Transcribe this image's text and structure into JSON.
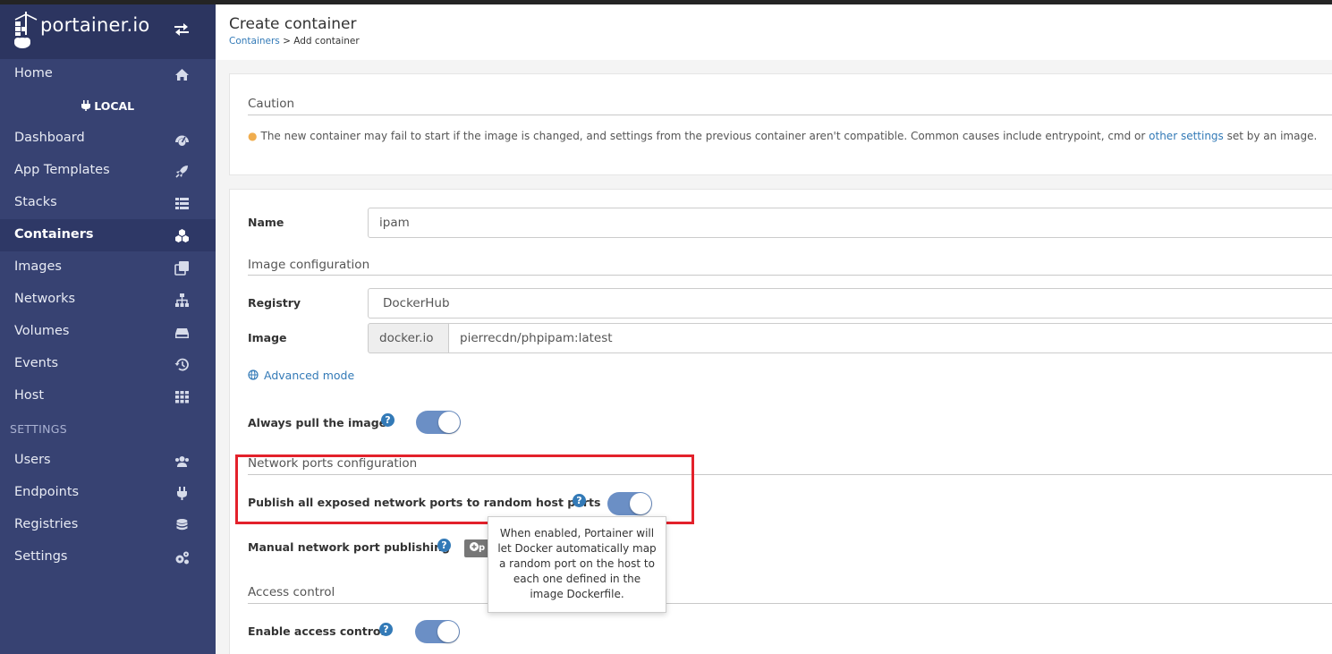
{
  "brand": {
    "name": "portainer.io"
  },
  "sidebar": {
    "home": "Home",
    "env_label": "LOCAL",
    "items": [
      {
        "label": "Dashboard",
        "icon": "tachometer-icon"
      },
      {
        "label": "App Templates",
        "icon": "rocket-icon"
      },
      {
        "label": "Stacks",
        "icon": "th-list-icon"
      },
      {
        "label": "Containers",
        "icon": "cubes-icon"
      },
      {
        "label": "Images",
        "icon": "clone-icon"
      },
      {
        "label": "Networks",
        "icon": "sitemap-icon"
      },
      {
        "label": "Volumes",
        "icon": "hdd-icon"
      },
      {
        "label": "Events",
        "icon": "history-icon"
      },
      {
        "label": "Host",
        "icon": "th-icon"
      }
    ],
    "settings_section": "SETTINGS",
    "settings_items": [
      {
        "label": "Users",
        "icon": "users-icon"
      },
      {
        "label": "Endpoints",
        "icon": "plug-icon"
      },
      {
        "label": "Registries",
        "icon": "database-icon"
      },
      {
        "label": "Settings",
        "icon": "cogs-icon"
      }
    ]
  },
  "header": {
    "title": "Create container",
    "breadcrumb_link": "Containers",
    "breadcrumb_rest": " > Add container"
  },
  "caution": {
    "legend": "Caution",
    "text_before": "The new container may fail to start if the image is changed, and settings from the previous container aren't compatible. Common causes include entrypoint, cmd or ",
    "link": "other settings",
    "text_after": " set by an image."
  },
  "form": {
    "name_label": "Name",
    "name_value": "ipam",
    "image_config_legend": "Image configuration",
    "registry_label": "Registry",
    "registry_value": "DockerHub",
    "image_label": "Image",
    "image_prefix": "docker.io",
    "image_value": "pierrecdn/phpipam:latest",
    "advanced_mode": "Advanced mode",
    "always_pull_label": "Always pull the image",
    "always_pull_on": true,
    "network_legend": "Network ports configuration",
    "publish_all_label": "Publish all exposed network ports to random host ports",
    "publish_all_on": true,
    "manual_publish_label": "Manual network port publishing",
    "publish_btn": "p",
    "access_legend": "Access control",
    "access_label": "Enable access control",
    "access_on": true
  },
  "tooltip": {
    "text": "When enabled, Portainer will let Docker automatically map a random port on the host to each one defined in the image Dockerfile."
  },
  "colors": {
    "sidebar": "#374272",
    "brand_bg": "#2c3560",
    "link": "#337ab7",
    "toggle_on": "#6b8fc5",
    "highlight": "#e3212b",
    "warning": "#f0ad4e"
  }
}
